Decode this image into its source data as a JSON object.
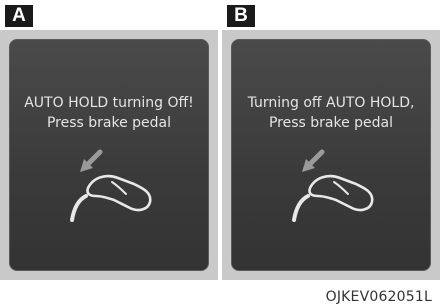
{
  "panels": [
    {
      "label": "A",
      "message_line1": "AUTO HOLD turning Off!",
      "message_line2": "Press brake pedal",
      "icon": "brake-pedal-icon"
    },
    {
      "label": "B",
      "message_line1": "Turning off AUTO HOLD,",
      "message_line2": "Press brake pedal",
      "icon": "brake-pedal-icon"
    }
  ],
  "figure_code": "OJKEV062051L",
  "colors": {
    "screen_background": "#3a3a3a",
    "frame": "#c9c9c9",
    "text": "#e4e4e4",
    "label_background": "#1a1a1a"
  }
}
